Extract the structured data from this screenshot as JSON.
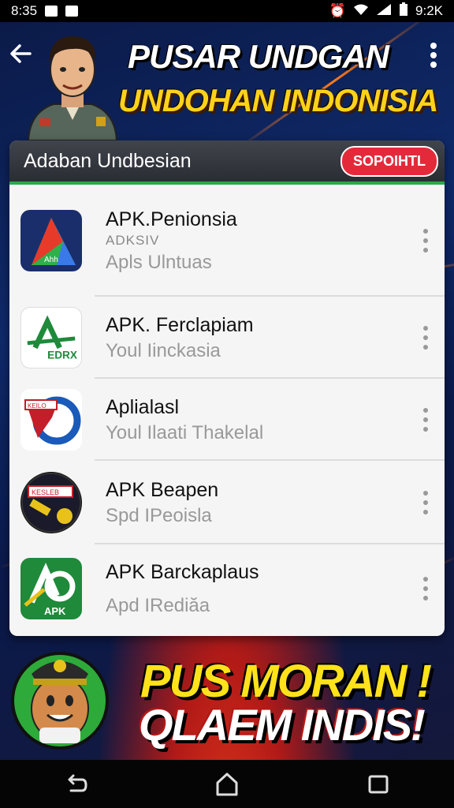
{
  "status_bar": {
    "time": "8:35",
    "right_time": "9:2K"
  },
  "header": {
    "title_line1": "PUSAR UNDGAN",
    "title_line2": "UNDOHAN INDONISIA"
  },
  "panel": {
    "title": "Adaban Undbesian",
    "action_label": "SOPOIHTL",
    "items": [
      {
        "name": "APK.Penionsia",
        "tag": "ADKSIV",
        "subtitle": "Apls Ulntuas",
        "icon": "triangle-logo-icon"
      },
      {
        "name": "APK. Ferclapiam",
        "tag": "",
        "subtitle": "Youl Iinckasia",
        "icon": "green-a-logo-icon"
      },
      {
        "name": "Aplialasl",
        "tag": "",
        "subtitle": "Youl Ilaati Thakelal",
        "icon": "red-flag-logo-icon"
      },
      {
        "name": "APK Beapen",
        "tag": "",
        "subtitle": "Spd IPeoisla",
        "icon": "hammer-badge-icon"
      },
      {
        "name": "APK Barckaplaus",
        "tag": "",
        "subtitle": "Apd IRediăa",
        "icon": "apk-logo-icon",
        "icon_text": "APK"
      }
    ]
  },
  "banner": {
    "line1": "PUS MORAN !",
    "line2": "QLAEM INDIS!"
  },
  "icon_labels": {
    "item1": "Ahh",
    "item2": "EDRX",
    "item3": "KEILO",
    "item4": "KESLEB"
  },
  "colors": {
    "accent_green": "#2aa84a",
    "pill_red": "#e42a3a",
    "title_yellow": "#ffd21a"
  }
}
